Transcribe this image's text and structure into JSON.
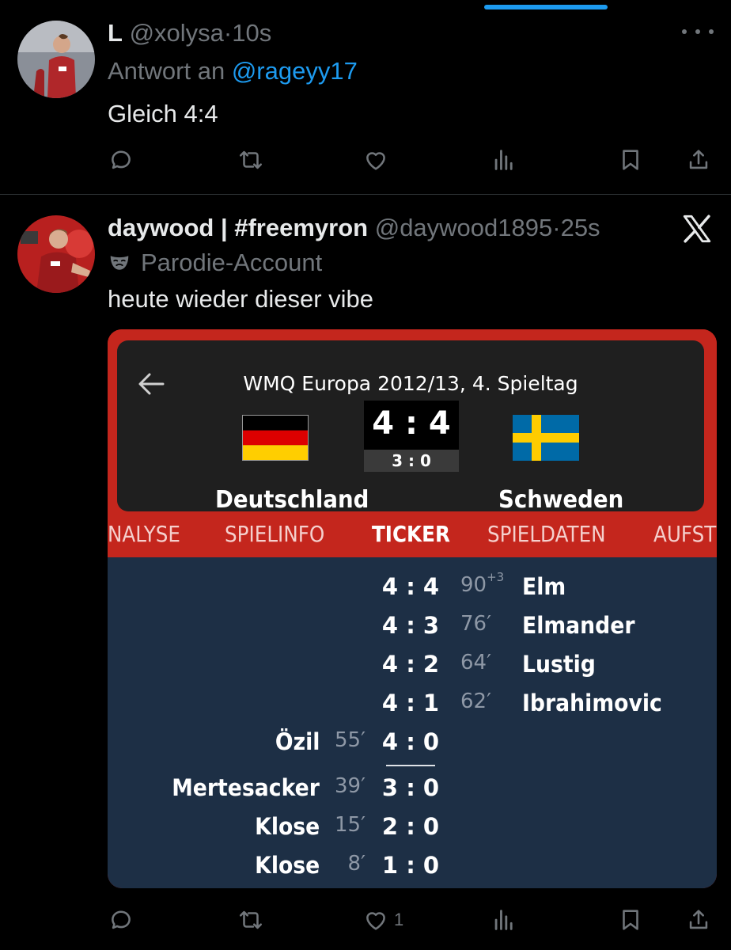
{
  "tweets": [
    {
      "name": "L",
      "handle": "@xolysa",
      "separator": "·",
      "time": "10s",
      "reply_prefix": "Antwort an",
      "reply_to": "@rageyy17",
      "text": "Gleich 4:4",
      "like_count": ""
    },
    {
      "name": "daywood | #freemyron",
      "handle": "@daywood1895",
      "separator": "·",
      "time": "25s",
      "parody_label": "Parodie-Account",
      "text": "heute wieder dieser vibe",
      "like_count": "1"
    }
  ],
  "media": {
    "match_title": "WMQ Europa 2012/13, 4. Spieltag",
    "score": "4 : 4",
    "halftime": "3 : 0",
    "home_team": "Deutschland",
    "away_team": "Schweden",
    "tabs": [
      "NALYSE",
      "SPIELINFO",
      "TICKER",
      "SPIELDATEN",
      "AUFST"
    ],
    "active_tab": "TICKER",
    "ticker": [
      {
        "score": "4 : 4",
        "minute": "90",
        "extra": "+3",
        "player": "Elm",
        "side": "away"
      },
      {
        "score": "4 : 3",
        "minute": "76′",
        "player": "Elmander",
        "side": "away"
      },
      {
        "score": "4 : 2",
        "minute": "64′",
        "player": "Lustig",
        "side": "away"
      },
      {
        "score": "4 : 1",
        "minute": "62′",
        "player": "Ibrahimovic",
        "side": "away"
      },
      {
        "score": "4 : 0",
        "minute": "55′",
        "player": "Özil",
        "side": "home"
      },
      {
        "score": "3 : 0",
        "minute": "39′",
        "player": "Mertesacker",
        "side": "home"
      },
      {
        "score": "2 : 0",
        "minute": "15′",
        "player": "Klose",
        "side": "home"
      },
      {
        "score": "1 : 0",
        "minute": "8′",
        "player": "Klose",
        "side": "home"
      }
    ]
  },
  "colors": {
    "accent": "#1d9bf0",
    "background": "#000000",
    "secondary_text": "#71767b",
    "kicker_red": "#c4261d",
    "ticker_bg": "#1d2f45"
  },
  "icons": [
    "reply-icon",
    "retweet-icon",
    "like-icon",
    "views-icon",
    "bookmark-icon",
    "share-icon",
    "more-icon",
    "x-logo-icon",
    "mask-icon",
    "back-arrow-icon"
  ]
}
